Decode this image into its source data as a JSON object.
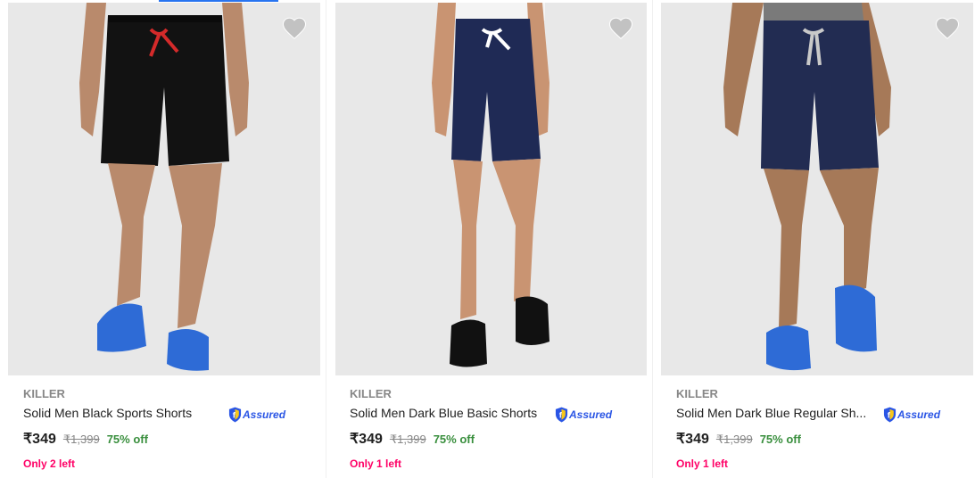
{
  "products": [
    {
      "brand": "KILLER",
      "title": "Solid Men Black Sports Shorts",
      "assured_label": "Assured",
      "price": "₹349",
      "mrp": "₹1,399",
      "discount": "75% off",
      "stock": "Only 2 left",
      "shorts_color": "#121212",
      "cord_color": "#d42a2a",
      "shoe_color": "#2e6bd6"
    },
    {
      "brand": "KILLER",
      "title": "Solid Men Dark Blue Basic Shorts",
      "assured_label": "Assured",
      "price": "₹349",
      "mrp": "₹1,399",
      "discount": "75% off",
      "stock": "Only 1 left",
      "shorts_color": "#1f2a55",
      "cord_color": "#ffffff",
      "shoe_color": "#111111"
    },
    {
      "brand": "KILLER",
      "title": "Solid Men Dark Blue Regular Sh...",
      "assured_label": "Assured",
      "price": "₹349",
      "mrp": "₹1,399",
      "discount": "75% off",
      "stock": "Only 1 left",
      "shorts_color": "#222c52",
      "cord_color": "#c9c9c9",
      "shoe_color": "#2e6bd6"
    }
  ],
  "colors": {
    "accent": "#2874f0",
    "discount": "#388e3c",
    "stock_warning": "#ff0066",
    "assured": "#2a55e5"
  },
  "icons": {
    "wishlist": "heart-icon",
    "assured": "assured-shield-icon"
  }
}
